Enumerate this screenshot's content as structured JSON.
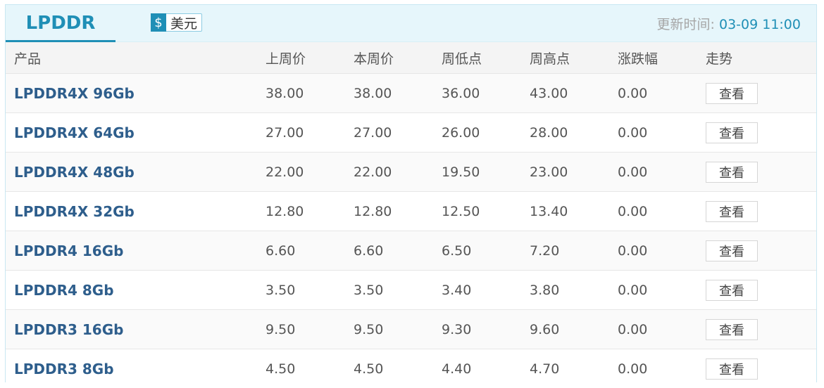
{
  "header": {
    "tab_label": "LPDDR",
    "currency_symbol": "$",
    "currency_label": "美元",
    "update_prefix": "更新时间: ",
    "update_time": "03-09 11:00"
  },
  "columns": [
    "产品",
    "上周价",
    "本周价",
    "周低点",
    "周高点",
    "涨跌幅",
    "走势"
  ],
  "view_label": "查看",
  "rows": [
    {
      "product": "LPDDR4X 96Gb",
      "last_week": "38.00",
      "this_week": "38.00",
      "week_low": "36.00",
      "week_high": "43.00",
      "change": "0.00"
    },
    {
      "product": "LPDDR4X 64Gb",
      "last_week": "27.00",
      "this_week": "27.00",
      "week_low": "26.00",
      "week_high": "28.00",
      "change": "0.00"
    },
    {
      "product": "LPDDR4X 48Gb",
      "last_week": "22.00",
      "this_week": "22.00",
      "week_low": "19.50",
      "week_high": "23.00",
      "change": "0.00"
    },
    {
      "product": "LPDDR4X 32Gb",
      "last_week": "12.80",
      "this_week": "12.80",
      "week_low": "12.50",
      "week_high": "13.40",
      "change": "0.00"
    },
    {
      "product": "LPDDR4 16Gb",
      "last_week": "6.60",
      "this_week": "6.60",
      "week_low": "6.50",
      "week_high": "7.20",
      "change": "0.00"
    },
    {
      "product": "LPDDR4 8Gb",
      "last_week": "3.50",
      "this_week": "3.50",
      "week_low": "3.40",
      "week_high": "3.80",
      "change": "0.00"
    },
    {
      "product": "LPDDR3 16Gb",
      "last_week": "9.50",
      "this_week": "9.50",
      "week_low": "9.30",
      "week_high": "9.60",
      "change": "0.00"
    },
    {
      "product": "LPDDR3 8Gb",
      "last_week": "4.50",
      "this_week": "4.50",
      "week_low": "4.40",
      "week_high": "4.70",
      "change": "0.00"
    }
  ]
}
